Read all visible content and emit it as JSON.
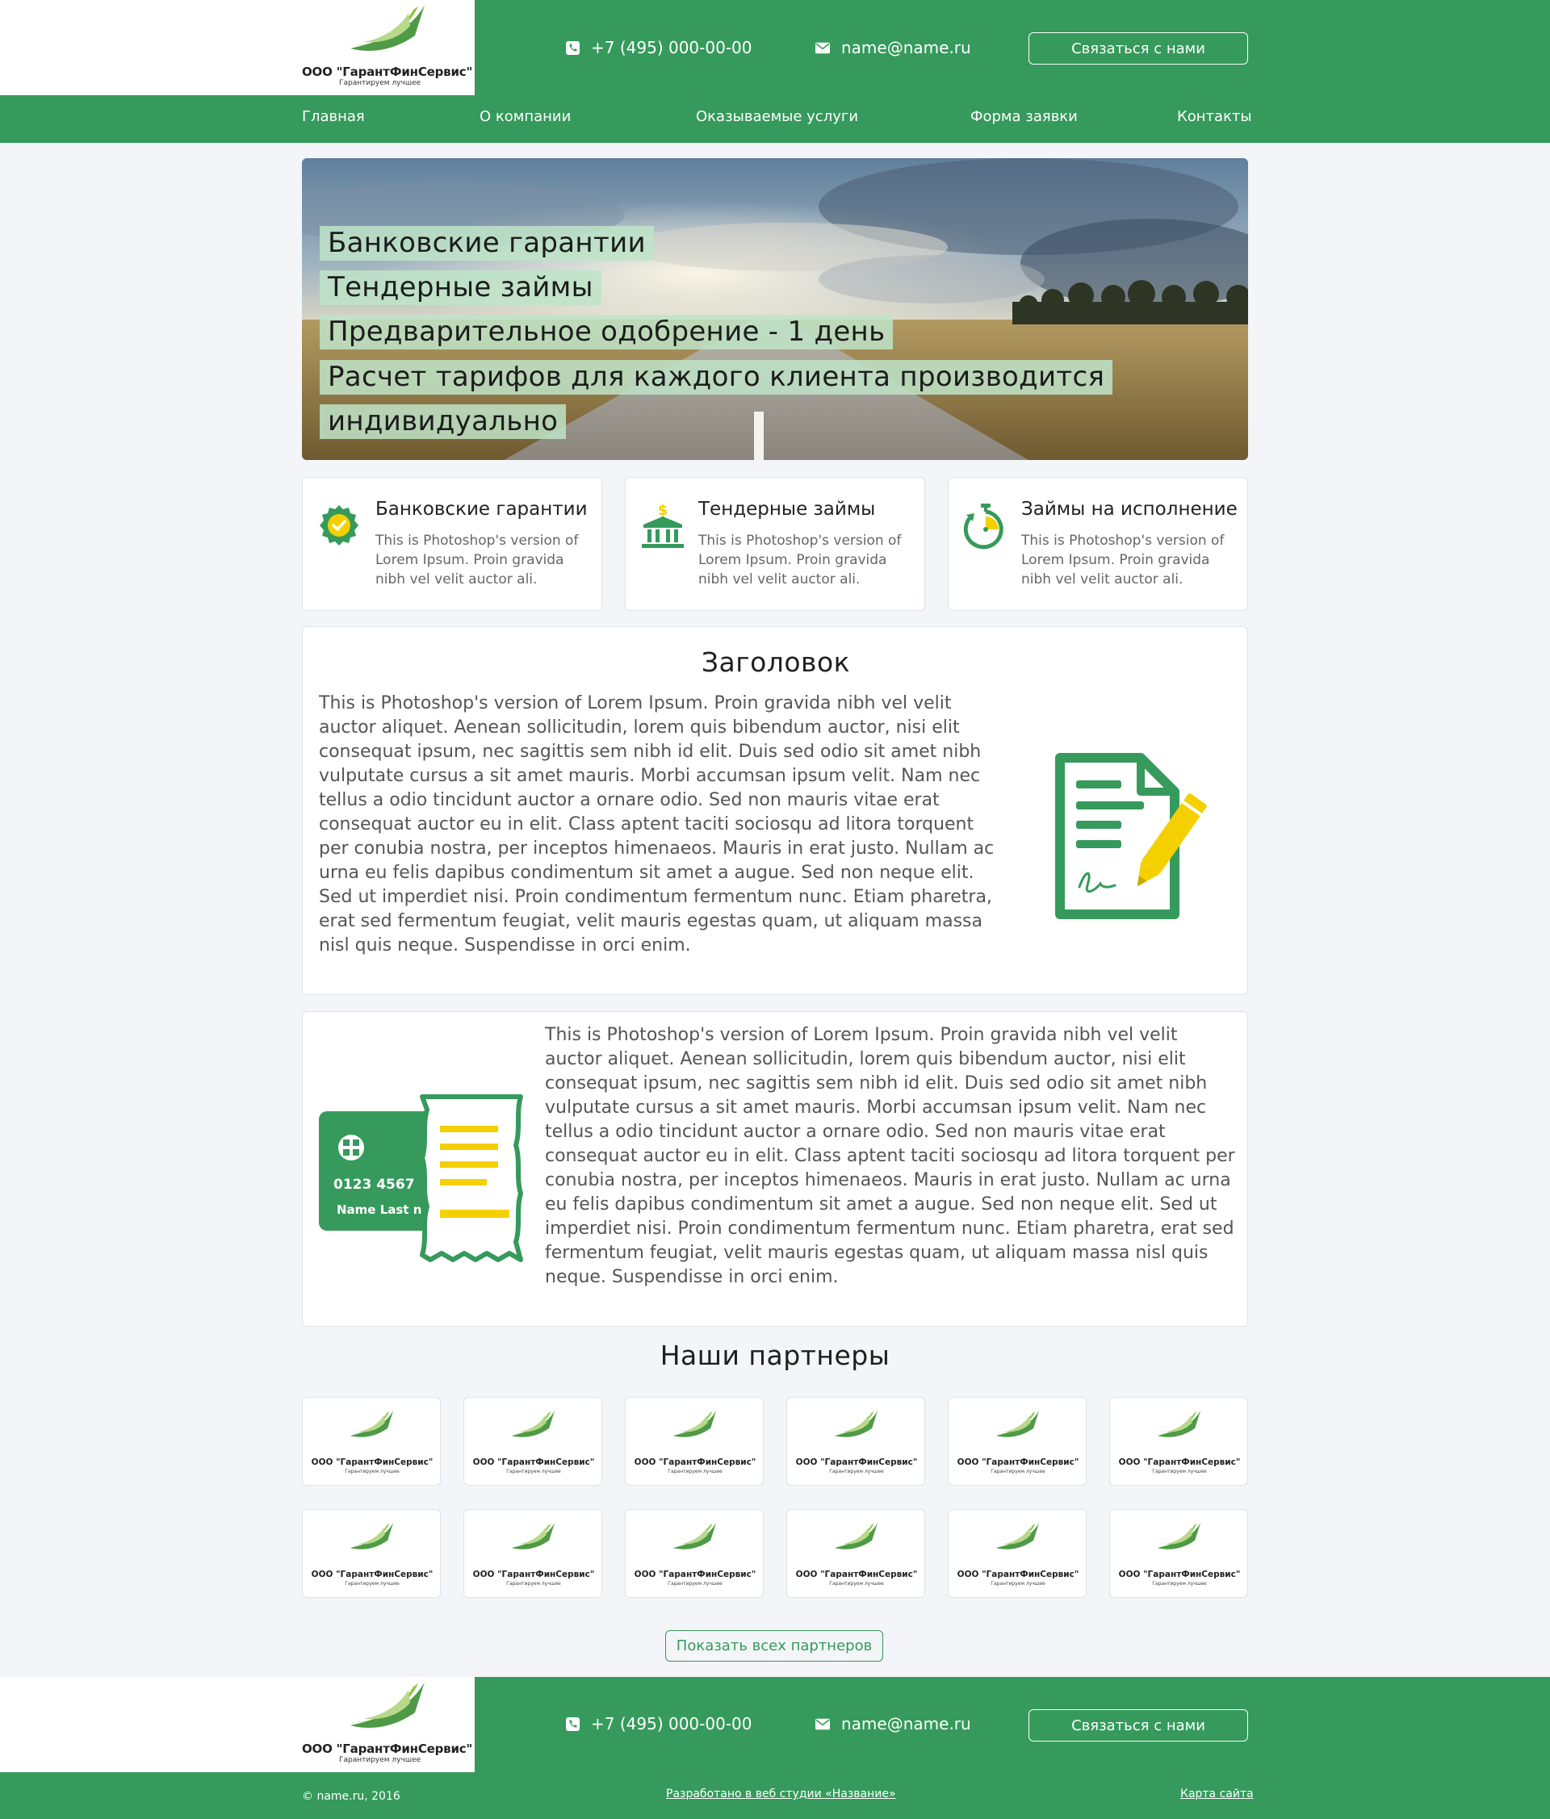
{
  "brand": {
    "name": "ООО \"ГарантФинСервис\"",
    "slogan": "Гарантируем лучшее",
    "colors": {
      "green": "#359a5b",
      "light_green": "#8cc63f",
      "yellow": "#f5d000"
    }
  },
  "header": {
    "phone": "+7 (495) 000-00-00",
    "email": "name@name.ru",
    "contact_button": "Связаться с нами",
    "phone_icon": "phone-icon",
    "email_icon": "envelope-icon"
  },
  "nav": {
    "items": [
      {
        "label": "Главная"
      },
      {
        "label": "О компании"
      },
      {
        "label": "Оказываемые услуги"
      },
      {
        "label": "Форма заявки"
      },
      {
        "label": "Контакты"
      }
    ]
  },
  "hero": {
    "lines": [
      "Банковские гарантии",
      "Тендерные займы",
      "Предварительное одобрение - 1 день",
      "Расчет тарифов для каждого клиента производится",
      "индивидуально"
    ]
  },
  "features": [
    {
      "icon": "badge-check-icon",
      "title": "Банковские гарантии",
      "text": "This is Photoshop's version of Lorem Ipsum. Proin gravida nibh vel velit auctor ali."
    },
    {
      "icon": "bank-dollar-icon",
      "title": "Тендерные займы",
      "text": "This is Photoshop's version of Lorem Ipsum. Proin gravida nibh vel velit auctor ali."
    },
    {
      "icon": "stopwatch-icon",
      "title": "Займы на исполнение",
      "text": "This is Photoshop's version of Lorem Ipsum. Proin gravida nibh vel velit auctor ali."
    }
  ],
  "article": {
    "title": "Заголовок",
    "text": "This is Photoshop's version  of Lorem Ipsum. Proin gravida nibh vel velit auctor aliquet. Aenean sollicitudin, lorem quis bibendum auctor, nisi elit consequat ipsum, nec sagittis sem nibh id elit. Duis sed odio sit amet nibh vulputate cursus a sit amet mauris. Morbi accumsan ipsum velit. Nam nec tellus a odio tincidunt auctor a ornare odio. Sed non  mauris vitae erat consequat auctor eu in elit. Class aptent taciti sociosqu ad litora torquent per conubia nostra, per inceptos himenaeos. Mauris in erat justo. Nullam ac urna eu felis dapibus condimentum sit amet a augue. Sed non neque elit. Sed ut imperdiet nisi. Proin condimentum fermentum nunc. Etiam pharetra, erat sed fermentum feugiat, velit mauris egestas quam, ut aliquam massa nisl quis neque. Suspendisse in orci enim.",
    "icon": "document-signature-icon"
  },
  "article2": {
    "text": "This is Photoshop's version  of Lorem Ipsum. Proin gravida nibh vel velit auctor aliquet. Aenean sollicitudin, lorem quis bibendum auctor, nisi elit consequat ipsum, nec sagittis sem nibh id elit. Duis sed odio sit amet nibh vulputate cursus a sit amet mauris. Morbi accumsan ipsum velit. Nam nec tellus a odio tincidunt auctor a ornare odio. Sed non  mauris vitae erat consequat auctor eu in elit. Class aptent taciti sociosqu ad litora torquent per conubia nostra, per inceptos himenaeos. Mauris in erat justo. Nullam ac urna eu felis dapibus condimentum sit amet a augue. Sed non neque elit. Sed ut imperdiet nisi. Proin condimentum fermentum nunc. Etiam pharetra, erat sed fermentum feugiat, velit mauris egestas quam, ut aliquam massa nisl quis neque. Suspendisse in orci enim.",
    "icon": "card-receipt-icon",
    "card_number": "0123  4567",
    "card_name": "Name  Last n"
  },
  "partners": {
    "title": "Наши партнеры",
    "count": 12,
    "show_all": "Показать всех партнеров"
  },
  "footer": {
    "phone": "+7 (495) 000-00-00",
    "email": "name@name.ru",
    "contact_button": "Связаться с нами",
    "copyright": "©  name.ru, 2016",
    "developer": "Разработано в веб студии «Название»",
    "sitemap": "Карта сайта"
  }
}
